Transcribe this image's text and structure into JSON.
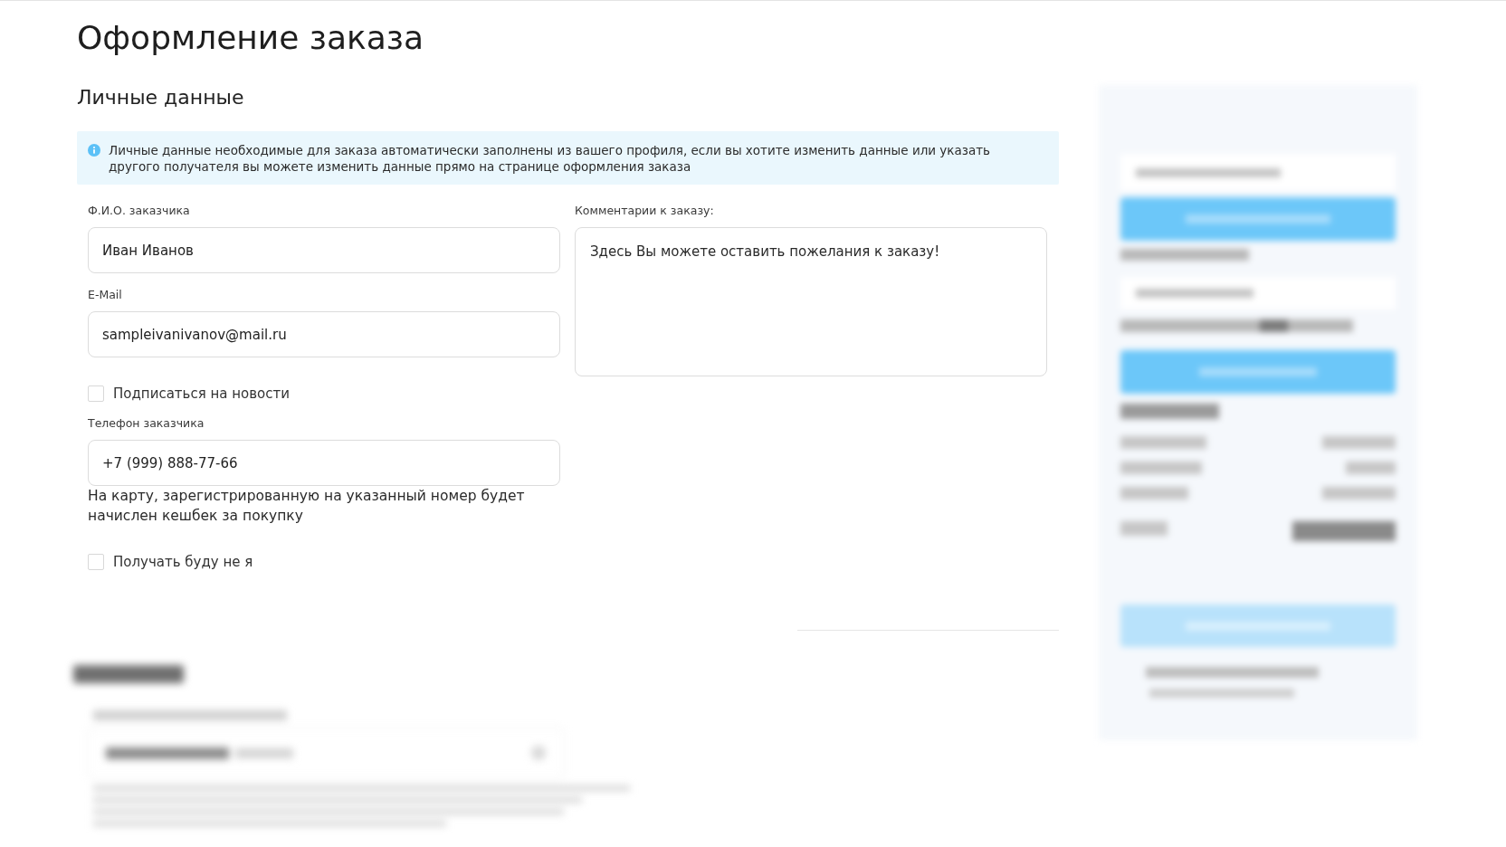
{
  "page": {
    "title": "Оформление заказа"
  },
  "personal_data": {
    "heading": "Личные данные",
    "notice": "Личные данные необходимые для заказа автоматически заполнены из вашего профиля, если вы хотите изменить данные или указать другого получателя вы можете изменить данные прямо на странице оформления заказа",
    "fields": [
      {
        "kind": "input",
        "label": "Ф.И.О. заказчика",
        "value": "Иван Иванов"
      },
      {
        "kind": "input",
        "label": "E-Mail",
        "value": "sampleivanivanov@mail.ru"
      },
      {
        "kind": "checkbox",
        "label": "Подписаться на новости",
        "checked": false
      },
      {
        "kind": "input",
        "label": "Телефон заказчика",
        "value": "+7 (999) 888-77-66",
        "hint": "На карту, зарегистрированную на указанный номер будет начислен кешбек за покупку"
      },
      {
        "kind": "checkbox",
        "label": "Получать буду не я",
        "checked": false
      }
    ],
    "comment": {
      "label": "Комментарии к заказу:",
      "placeholder": "Здесь Вы можете оставить пожелания к заказу!"
    }
  },
  "delivery_section": {
    "obscured": true
  },
  "order_summary": {
    "obscured": true
  }
}
